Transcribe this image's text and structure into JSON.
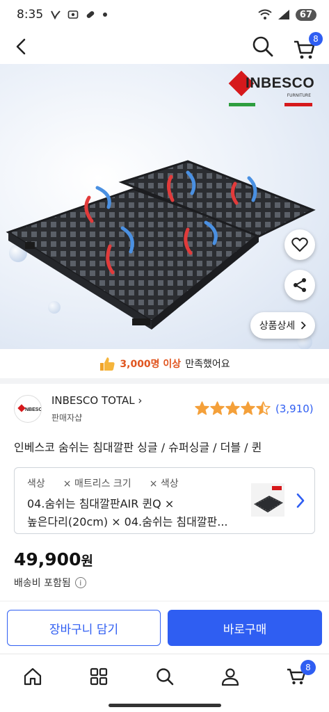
{
  "status_bar": {
    "time": "8:35",
    "battery": "67",
    "icons": [
      "vpn-key-icon",
      "screenshot-icon",
      "pill-icon",
      "dot-icon",
      "wifi-icon",
      "signal-icon"
    ]
  },
  "header": {
    "cart_badge": "8"
  },
  "hero": {
    "brand": "INBESCO",
    "brand_sub": "FURNITURE",
    "detail_button": "상품상세"
  },
  "satisfaction": {
    "highlight": "3,000명 이상",
    "rest": "만족했어요"
  },
  "seller": {
    "name": "INBESCO TOTAL",
    "type": "판매자샵",
    "rating_value": 4.5,
    "review_count": "(3,910)"
  },
  "product": {
    "title": "인베스코 숨쉬는 침대깔판 싱글 / 슈퍼싱글 / 더블 / 퀸",
    "price": "49,900",
    "price_unit": "원",
    "shipping": "배송비 포함됨"
  },
  "options": {
    "labels": [
      "색상",
      "× 매트리스 크기",
      "× 색상"
    ],
    "line1": "04.숨쉬는 침대깔판AIR 퀸Q ×",
    "line2": "높은다리(20cm) × 04.숨쉬는 침대깔판..."
  },
  "actions": {
    "add_to_cart": "장바구니 담기",
    "buy_now": "바로구매"
  },
  "bottom_nav": {
    "items": [
      "home-icon",
      "category-icon",
      "search-icon",
      "user-icon",
      "cart-icon"
    ],
    "cart_badge": "8"
  },
  "colors": {
    "accent": "#2f5ef2",
    "highlight": "#e0551f",
    "star": "#f4a03a",
    "brand_red": "#d6191c",
    "brand_green": "#2e9e3f"
  }
}
